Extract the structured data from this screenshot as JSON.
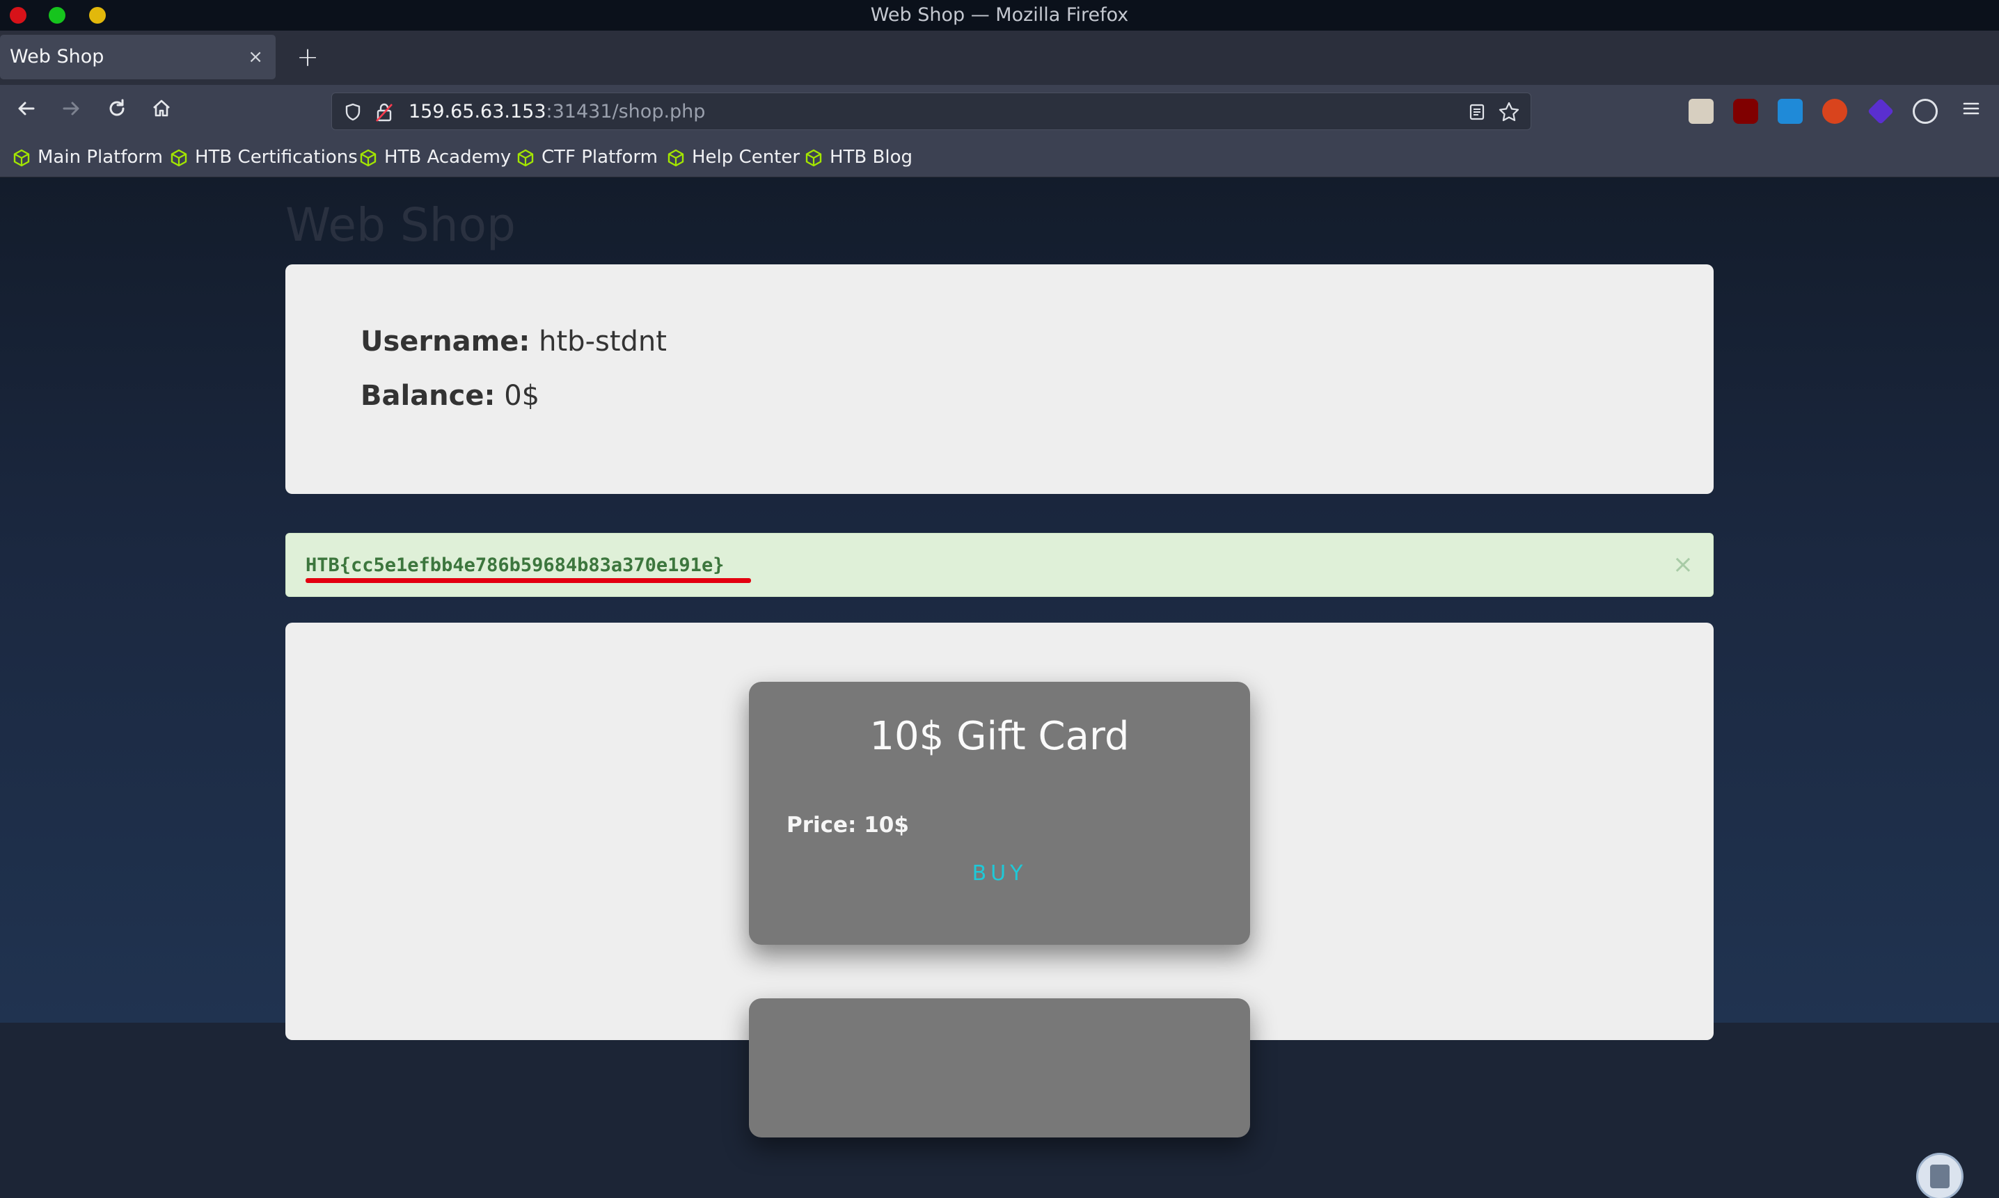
{
  "window": {
    "title": "Web Shop — Mozilla Firefox"
  },
  "tab": {
    "title": "Web Shop",
    "close": "×",
    "new_tab": "+"
  },
  "navbar": {
    "url_host": "159.65.63.153",
    "url_rest": ":31431/shop.php"
  },
  "bookmarks": [
    {
      "label": "Main Platform"
    },
    {
      "label": "HTB Certifications"
    },
    {
      "label": "HTB Academy"
    },
    {
      "label": "CTF Platform"
    },
    {
      "label": "Help Center"
    },
    {
      "label": "HTB Blog"
    }
  ],
  "page": {
    "heading": "Web Shop",
    "username_label": "Username:",
    "username_value": "htb-stdnt",
    "balance_label": "Balance:",
    "balance_value": "0$",
    "flag": "HTB{cc5e1efbb4e786b59684b83a370e191e}",
    "alert_close": "×",
    "card": {
      "title": "10$ Gift Card",
      "price": "Price: 10$",
      "buy": "BUY"
    }
  },
  "colors": {
    "accent_buy": "#1ec9d8",
    "flag_text": "#3c763d",
    "alert_bg": "#dff0d8",
    "underline": "#e3000f",
    "bookmark_icon": "#a3e600"
  }
}
